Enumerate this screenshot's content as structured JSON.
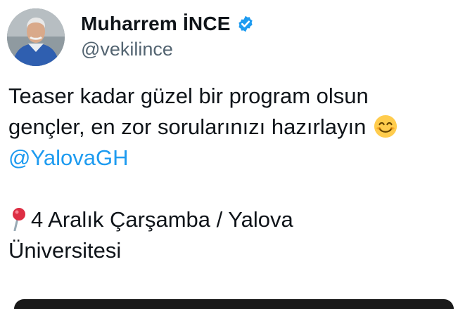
{
  "author": {
    "display_name": "Muharrem İNCE",
    "handle": "@vekilince",
    "verified": true
  },
  "tweet": {
    "line1": "Teaser kadar güzel bir program olsun",
    "line2": "gençler, en zor sorularınızı hazırlayın",
    "emoji_1": "smiling-face-icon",
    "mention": "@YalovaGH",
    "pin_icon": "round-pushpin-icon",
    "location_line1": "4 Aralık Çarşamba / Yalova",
    "location_line2": "Üniversitesi"
  },
  "colors": {
    "text": "#0f1419",
    "handle": "#536471",
    "mention": "#1d9bf0",
    "verified_badge": "#1d9bf0"
  }
}
